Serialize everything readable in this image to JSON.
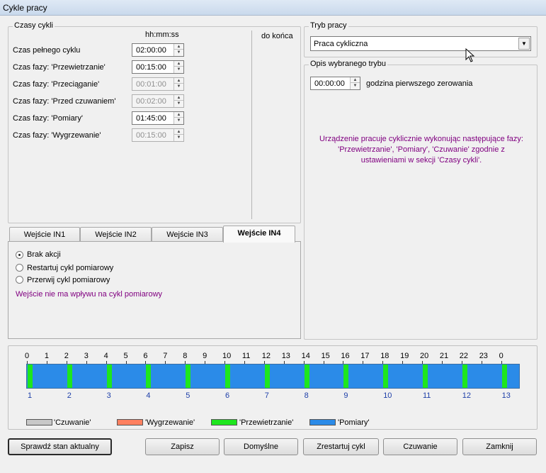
{
  "window": {
    "title": "Cykle pracy"
  },
  "cycle_times": {
    "title": "Czasy cykli",
    "column_header": "hh:mm:ss",
    "remaining_header": "do końca",
    "rows": [
      {
        "label": "Czas pełnego cyklu",
        "value": "02:00:00",
        "enabled": true
      },
      {
        "label": "Czas fazy: 'Przewietrzanie'",
        "value": "00:15:00",
        "enabled": true
      },
      {
        "label": "Czas fazy: 'Przeciąganie'",
        "value": "00:01:00",
        "enabled": false
      },
      {
        "label": "Czas fazy: 'Przed czuwaniem'",
        "value": "00:02:00",
        "enabled": false
      },
      {
        "label": "Czas fazy: 'Pomiary'",
        "value": "01:45:00",
        "enabled": true
      },
      {
        "label": "Czas fazy: 'Wygrzewanie'",
        "value": "00:15:00",
        "enabled": false
      }
    ]
  },
  "input_tabs": {
    "tabs": [
      "Wejście IN1",
      "Wejście IN2",
      "Wejście IN3",
      "Wejście IN4"
    ],
    "active_tab": "Wejście IN4",
    "options": [
      {
        "label": "Brak akcji",
        "checked": true
      },
      {
        "label": "Restartuj cykl pomiarowy",
        "checked": false
      },
      {
        "label": "Przerwij cykl pomiarowy",
        "checked": false
      }
    ],
    "note": "Wejście nie ma wpływu na cykl pomiarowy"
  },
  "mode": {
    "title": "Tryb pracy",
    "selected": "Praca cykliczna"
  },
  "mode_description": {
    "title": "Opis wybranego trybu",
    "time_value": "00:00:00",
    "time_label": "godzina pierwszego zerowania",
    "description_lines": [
      "Urządzenie pracuje cyklicznie wykonując następujące fazy:",
      "'Przewietrzanie', 'Pomiary', 'Czuwanie' zgodnie z",
      "ustawieniami w sekcji 'Czasy cykli'."
    ]
  },
  "timeline": {
    "hours": [
      "0",
      "1",
      "2",
      "3",
      "4",
      "5",
      "6",
      "7",
      "8",
      "9",
      "10",
      "11",
      "12",
      "13",
      "14",
      "15",
      "16",
      "17",
      "18",
      "19",
      "20",
      "21",
      "22",
      "23",
      "0"
    ],
    "cycles": [
      "1",
      "2",
      "3",
      "4",
      "5",
      "6",
      "7",
      "8",
      "9",
      "10",
      "11",
      "12",
      "13"
    ],
    "cycle_start_hours": [
      0,
      2,
      4,
      6,
      8,
      10,
      12,
      14,
      16,
      18,
      20,
      22,
      24
    ],
    "ventilation_hours": 0.25,
    "span_hours": 25,
    "legend": [
      {
        "label": "'Czuwanie'",
        "color": "#c8c8c8"
      },
      {
        "label": "'Wygrzewanie'",
        "color": "#ff8060"
      },
      {
        "label": "'Przewietrzanie'",
        "color": "#1ee61e"
      },
      {
        "label": "'Pomiary'",
        "color": "#2b8be8"
      }
    ]
  },
  "buttons": {
    "check_status": "Sprawdź stan aktualny",
    "save": "Zapisz",
    "defaults": "Domyślne",
    "restart_cycle": "Zrestartuj cykl",
    "standby": "Czuwanie",
    "close": "Zamknij"
  }
}
